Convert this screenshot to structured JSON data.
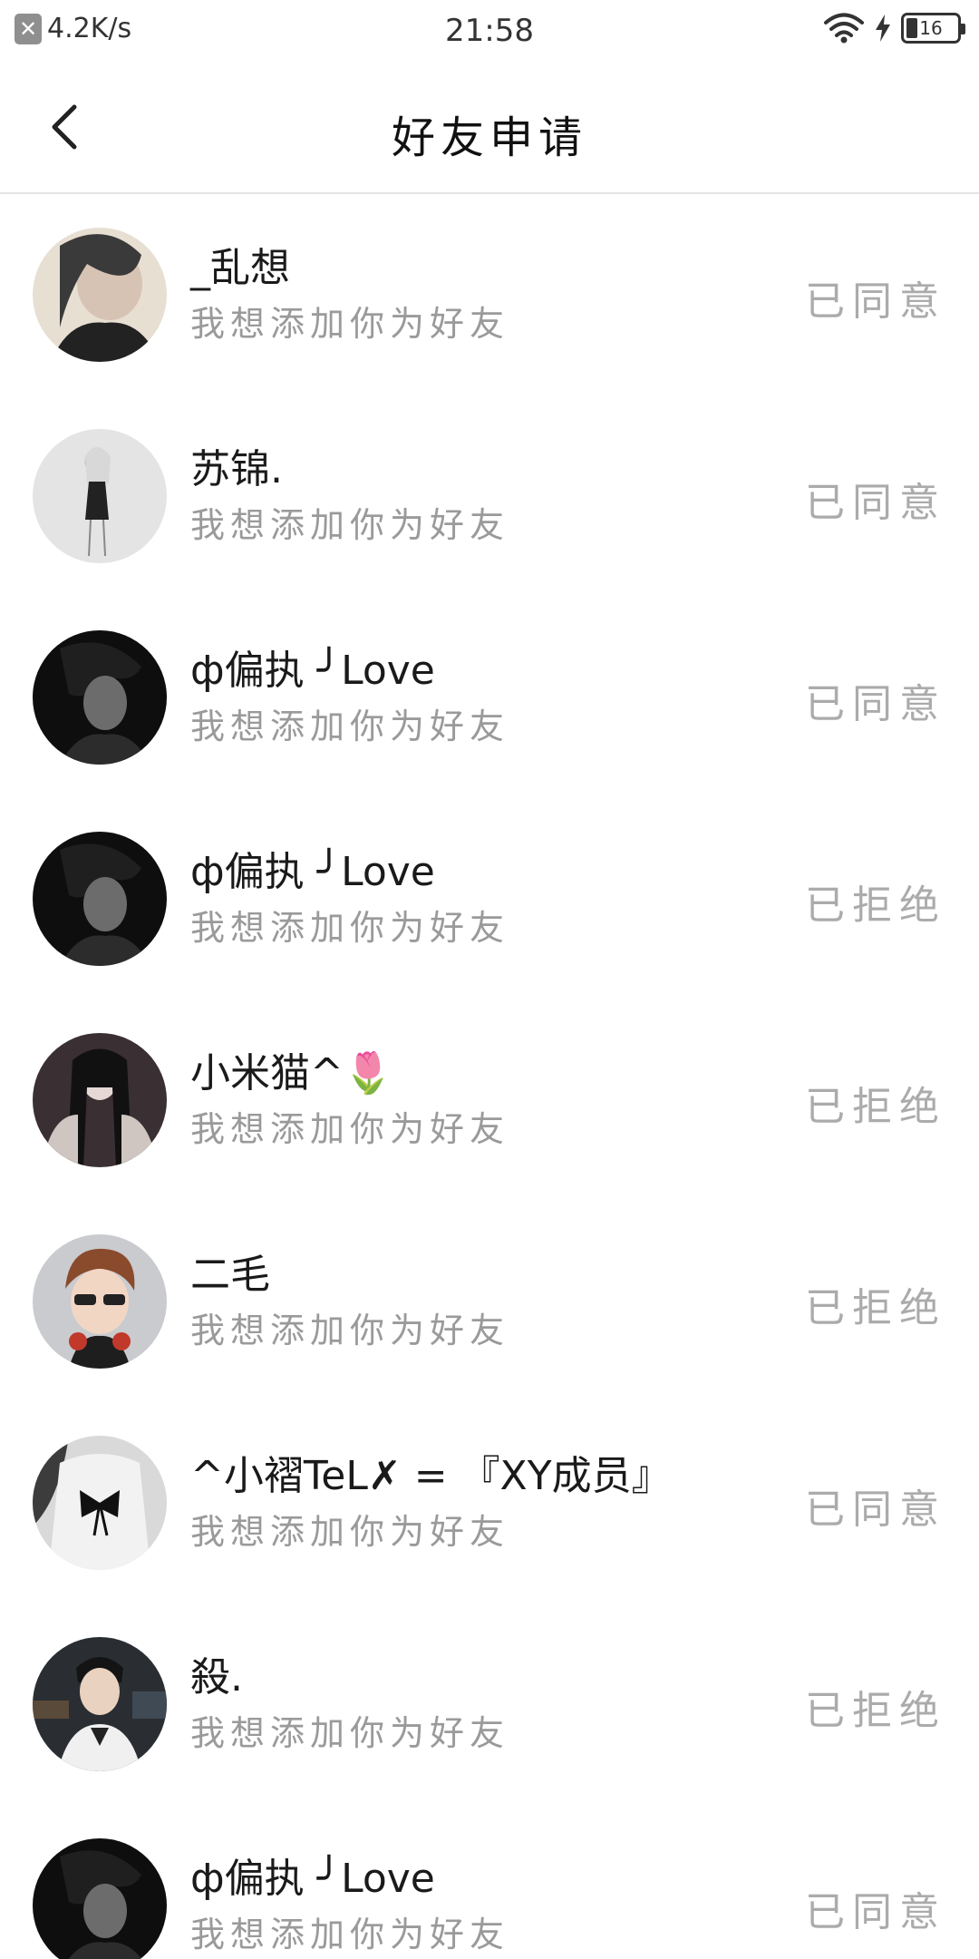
{
  "status_bar": {
    "speed": "4.2K/s",
    "time": "21:58",
    "battery": "16"
  },
  "header": {
    "title": "好友申请"
  },
  "requests": [
    {
      "name": "_乱想",
      "message": "我想添加你为好友",
      "status": "已同意"
    },
    {
      "name": "苏锦.",
      "message": "我想添加你为好友",
      "status": "已同意"
    },
    {
      "name": "ф偏执 ╯Love",
      "message": "我想添加你为好友",
      "status": "已同意"
    },
    {
      "name": "ф偏执 ╯Love",
      "message": "我想添加你为好友",
      "status": "已拒绝"
    },
    {
      "name": "小米猫^🌷",
      "message": "我想添加你为好友",
      "status": "已拒绝"
    },
    {
      "name": "二毛",
      "message": "我想添加你为好友",
      "status": "已拒绝"
    },
    {
      "name": "^小褶TeL✗ = 『XY成员』",
      "message": "我想添加你为好友",
      "status": "已同意"
    },
    {
      "name": "殺.",
      "message": "我想添加你为好友",
      "status": "已拒绝"
    },
    {
      "name": "ф偏执 ╯Love",
      "message": "我想添加你为好友",
      "status": "已同意"
    }
  ]
}
